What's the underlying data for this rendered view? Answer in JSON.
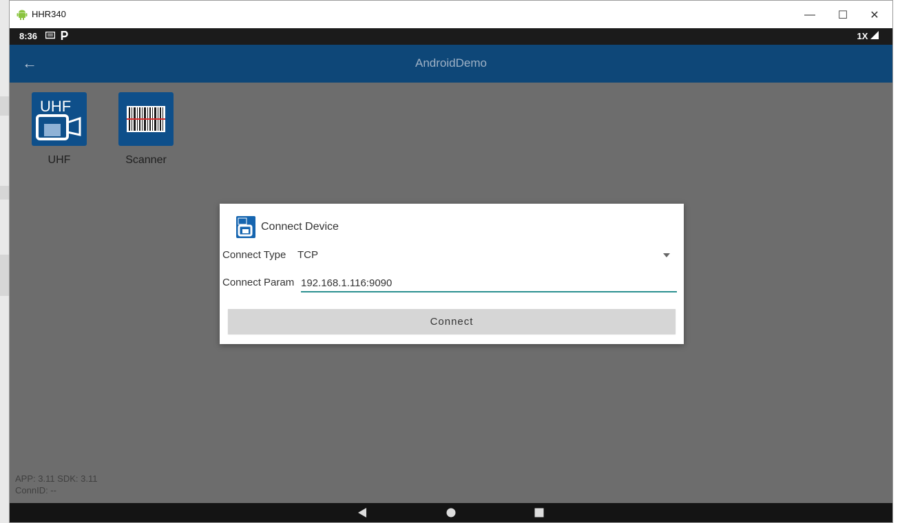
{
  "window": {
    "title": "HHR340",
    "controls": {
      "minimize": "—",
      "maximize": "☐",
      "close": "✕"
    }
  },
  "statusbar": {
    "time": "8:36",
    "right": "1X"
  },
  "actionbar": {
    "title": "AndroidDemo"
  },
  "apps": [
    {
      "label": "UHF",
      "icon_text": "UHF"
    },
    {
      "label": "Scanner"
    }
  ],
  "footer": {
    "version": "APP: 3.11  SDK: 3.11",
    "conn_id": "ConnID: --"
  },
  "dialog": {
    "title": "Connect Device",
    "type_label": "Connect Type",
    "type_value": "TCP",
    "param_label": "Connect Param",
    "param_value": "192.168.1.116:9090",
    "connect_label": "Connect"
  },
  "colors": {
    "actionbar": "#0e4778",
    "tile": "#0e4f8a",
    "accent_underline": "#2a8f8f",
    "screen_bg": "#6d6d6d"
  }
}
